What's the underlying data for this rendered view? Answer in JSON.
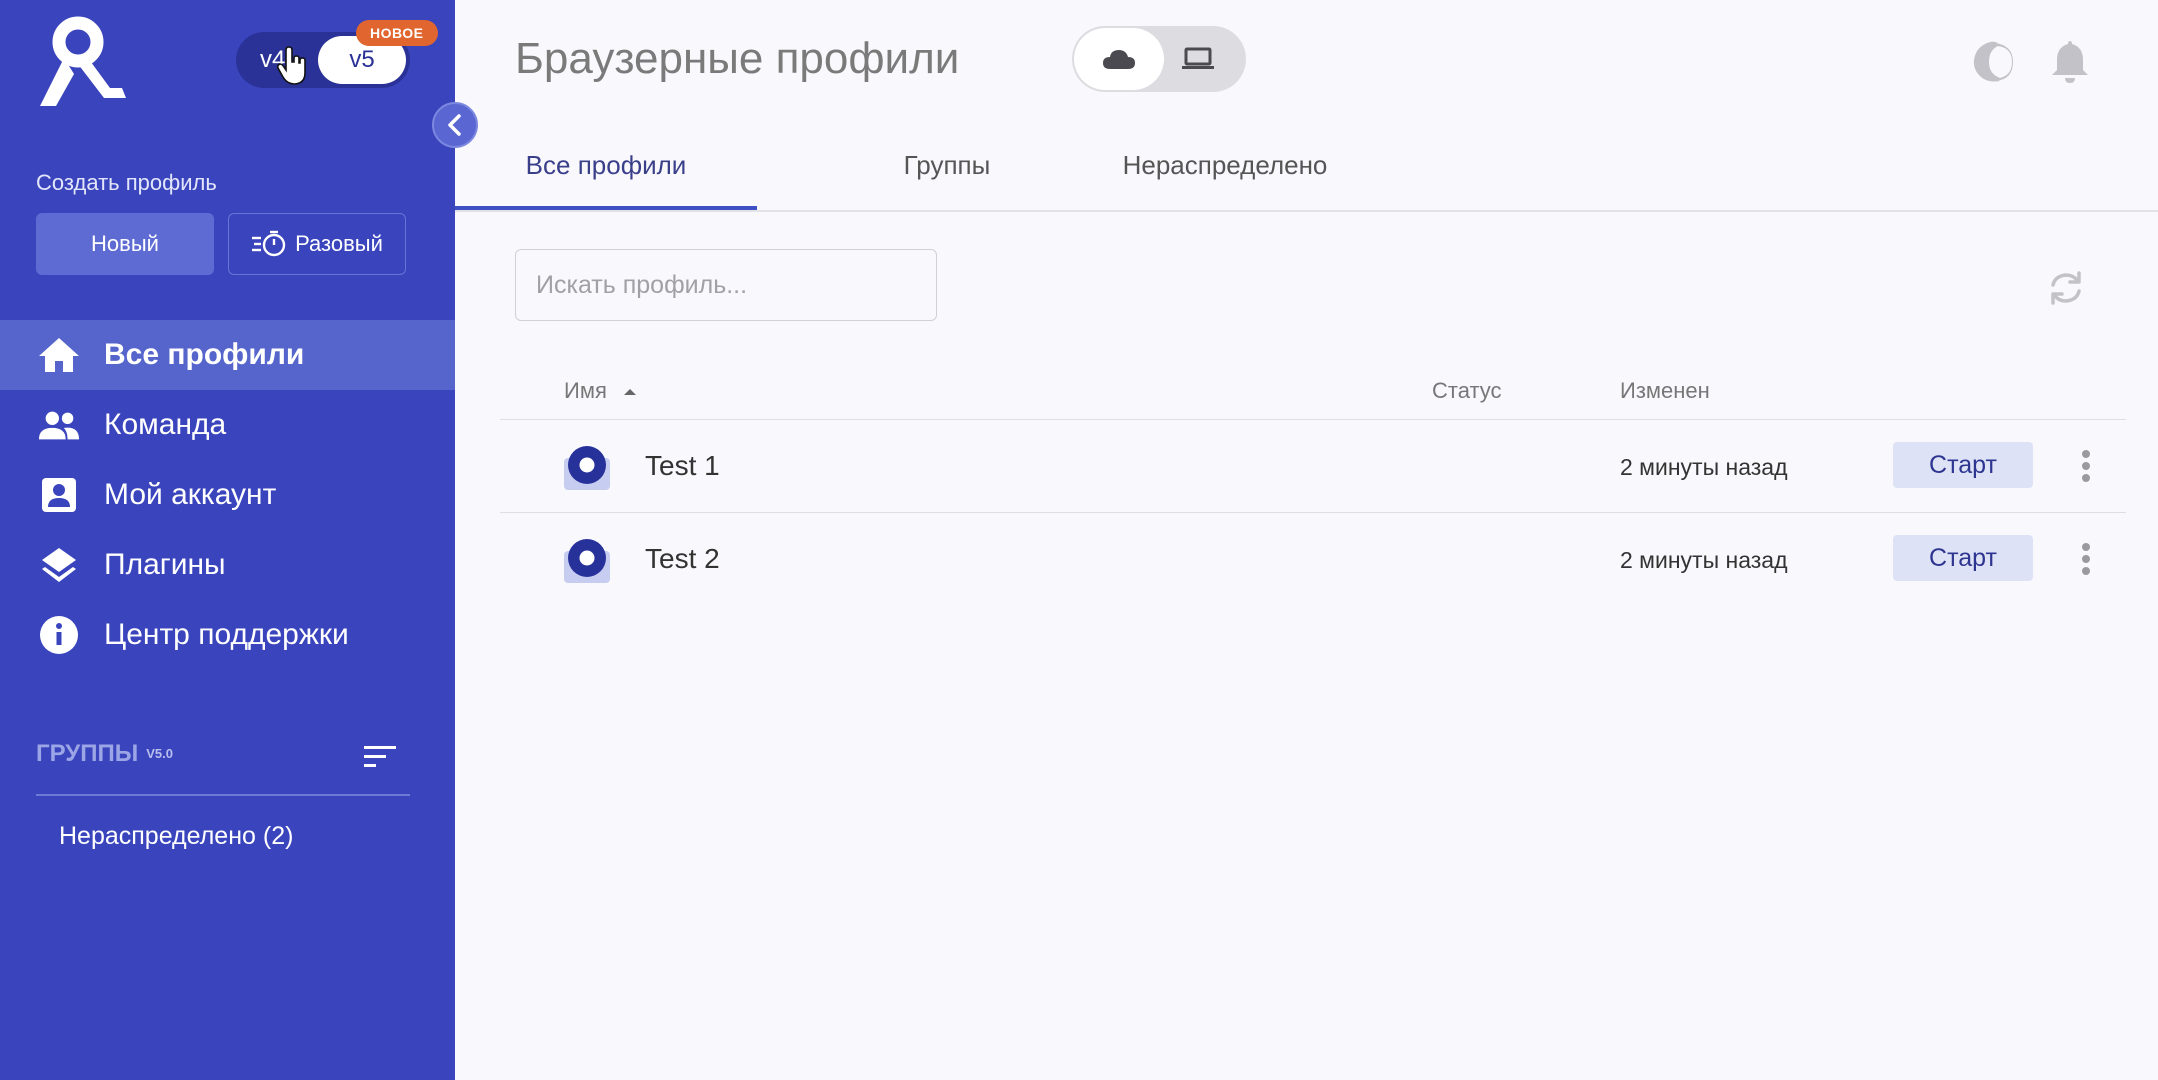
{
  "sidebar": {
    "version_toggle": {
      "left": "v4",
      "right": "v5",
      "badge": "НОВОЕ"
    },
    "create_label": "Создать профиль",
    "new_button": "Новый",
    "once_button": "Разовый",
    "nav_items": [
      {
        "label": "Все профили",
        "icon": "home-icon",
        "active": true
      },
      {
        "label": "Команда",
        "icon": "team-icon",
        "active": false
      },
      {
        "label": "Мой аккаунт",
        "icon": "account-icon",
        "active": false
      },
      {
        "label": "Плагины",
        "icon": "layers-icon",
        "active": false
      },
      {
        "label": "Центр поддержки",
        "icon": "info-icon",
        "active": false
      }
    ],
    "groups_title": "ГРУППЫ",
    "groups_version": "V5.0",
    "group_items": [
      {
        "label": "Нераспределено (2)"
      }
    ]
  },
  "header": {
    "title": "Браузерные профили",
    "storage_options": [
      "cloud-icon",
      "laptop-icon"
    ],
    "selected_storage": "cloud"
  },
  "tabs": [
    {
      "label": "Все профили",
      "active": true
    },
    {
      "label": "Группы",
      "active": false
    },
    {
      "label": "Нераспределено",
      "active": false
    }
  ],
  "search": {
    "placeholder": "Искать профиль...",
    "value": ""
  },
  "table": {
    "columns": {
      "name": "Имя",
      "status": "Статус",
      "modified": "Изменен"
    },
    "sort": {
      "column": "name",
      "direction": "asc"
    },
    "rows": [
      {
        "name": "Test 1",
        "status": "",
        "modified": "2 минуты назад",
        "action": "Старт"
      },
      {
        "name": "Test 2",
        "status": "",
        "modified": "2 минуты назад",
        "action": "Старт"
      }
    ]
  },
  "colors": {
    "sidebar_bg": "#3a45bd",
    "sidebar_active": "#5565cc",
    "accent": "#3f4fc4",
    "badge": "#e0652f",
    "start_button_bg": "#dde2f6"
  }
}
